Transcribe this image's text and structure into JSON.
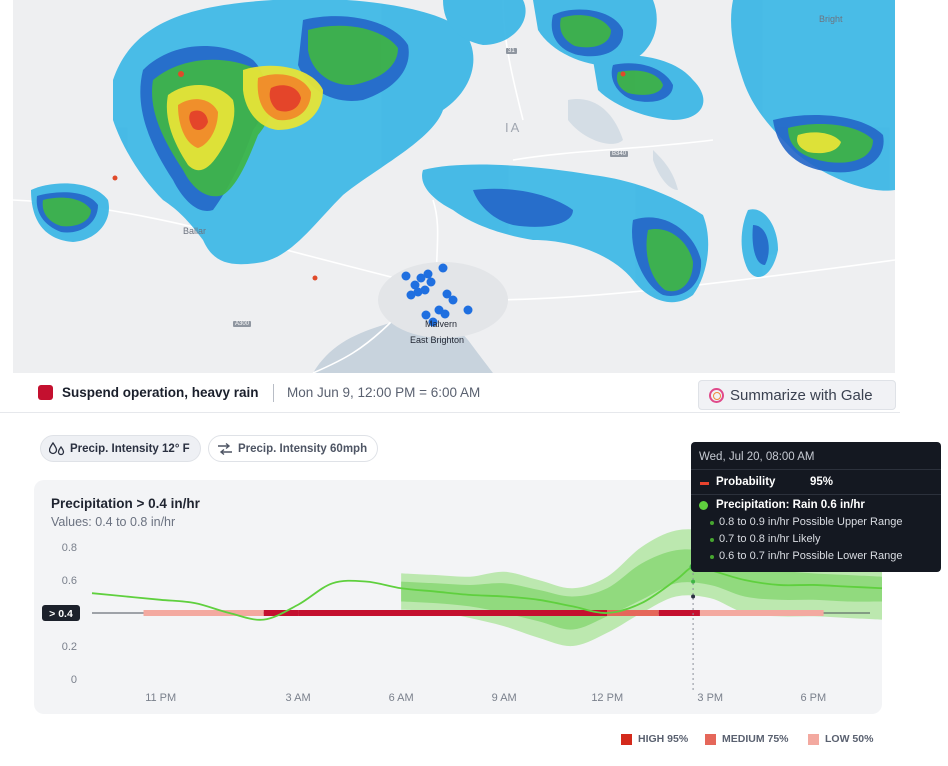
{
  "map": {
    "labels": [
      "Bright",
      "Ballar",
      "Malvern",
      "East Brighton"
    ],
    "roads": [
      "B340",
      "A300",
      "31"
    ],
    "partial_label": "IA"
  },
  "alert": {
    "title": "Suspend operation, heavy rain",
    "time": "Mon Jun 9, 12:00 PM = 6:00 AM",
    "color": "#c4102f",
    "gale_button": "Summarize with Gale"
  },
  "chips": [
    {
      "label": "Precip. Intensity 12° F",
      "icon": "droplets-icon"
    },
    {
      "label": "Precip. Intensity 60mph",
      "icon": "wind-icon"
    }
  ],
  "chart_header": {
    "title": "Precipitation > 0.4 in/hr",
    "subtitle": "Values: 0.4 to 0.8 in/hr"
  },
  "tooltip": {
    "date": "Wed, Jul 20, 08:00 AM",
    "probability_label": "Probability",
    "probability_value": "95%",
    "precip_label": "Precipitation: Rain 0.6 in/hr",
    "ranges": [
      "0.8 to 0.9 in/hr Possible Upper Range",
      "0.7 to 0.8 in/hr Likely",
      "0.6 to 0.7 in/hr Possible Lower Range"
    ]
  },
  "chart_data": {
    "type": "line",
    "xlabel": "",
    "ylabel": "",
    "x_ticks": [
      "11 PM",
      "3 AM",
      "6 AM",
      "9 AM",
      "12 PM",
      "3 PM",
      "6 PM"
    ],
    "x_tick_hours": [
      23,
      27,
      30,
      33,
      36,
      39,
      42
    ],
    "xlim": [
      21,
      44
    ],
    "y_ticks": [
      "0",
      "0.2",
      "0.4",
      "0.6",
      "0.8"
    ],
    "y_tick_values": [
      0,
      0.2,
      0.4,
      0.6,
      0.8
    ],
    "ylim": [
      0,
      0.8
    ],
    "threshold": {
      "label": "> 0.4",
      "value": 0.4
    },
    "series": [
      {
        "name": "Precipitation",
        "color": "#5fd03e",
        "x": [
          21.0,
          22.0,
          23.0,
          24.0,
          25.0,
          26.0,
          27.0,
          28.0,
          29.0,
          30.0,
          31.0,
          32.0,
          33.0,
          34.0,
          35.0,
          36.0,
          37.0,
          38.0,
          38.5,
          39.0,
          40.0,
          41.0,
          42.0,
          43.0,
          44.0
        ],
        "y": [
          0.52,
          0.5,
          0.48,
          0.46,
          0.4,
          0.36,
          0.45,
          0.58,
          0.59,
          0.55,
          0.53,
          0.51,
          0.5,
          0.48,
          0.44,
          0.4,
          0.46,
          0.6,
          0.68,
          0.66,
          0.6,
          0.57,
          0.57,
          0.56,
          0.55
        ]
      }
    ],
    "bands": {
      "start": 30.0,
      "upper": [
        0.64,
        0.63,
        0.62,
        0.65,
        0.6,
        0.55,
        0.62,
        0.8,
        0.9,
        0.89,
        0.8,
        0.75,
        0.72,
        0.71,
        0.7
      ],
      "likely_hi": [
        0.59,
        0.58,
        0.57,
        0.58,
        0.54,
        0.5,
        0.55,
        0.7,
        0.78,
        0.77,
        0.7,
        0.66,
        0.64,
        0.63,
        0.62
      ],
      "likely_lo": [
        0.47,
        0.46,
        0.44,
        0.4,
        0.35,
        0.3,
        0.38,
        0.48,
        0.58,
        0.57,
        0.5,
        0.48,
        0.48,
        0.47,
        0.47
      ],
      "lower": [
        0.42,
        0.41,
        0.37,
        0.32,
        0.25,
        0.2,
        0.28,
        0.4,
        0.5,
        0.49,
        0.4,
        0.38,
        0.38,
        0.37,
        0.36
      ]
    },
    "probability_segments": [
      {
        "from": 22.5,
        "to": 26.0,
        "level": "low"
      },
      {
        "from": 26.0,
        "to": 27.0,
        "level": "high"
      },
      {
        "from": 27.0,
        "to": 36.0,
        "level": "high"
      },
      {
        "from": 36.0,
        "to": 37.5,
        "level": "medium"
      },
      {
        "from": 37.5,
        "to": 38.7,
        "level": "high"
      },
      {
        "from": 38.7,
        "to": 42.3,
        "level": "low"
      }
    ],
    "marker_x": 38.5,
    "marker_points": [
      0.81,
      0.74,
      0.68,
      0.59,
      0.5
    ],
    "legend": [
      {
        "label": "HIGH 95%",
        "color": "#d42a1c"
      },
      {
        "label": "MEDIUM 75%",
        "color": "#e5675a"
      },
      {
        "label": "LOW 50%",
        "color": "#f3a9a0"
      }
    ]
  }
}
